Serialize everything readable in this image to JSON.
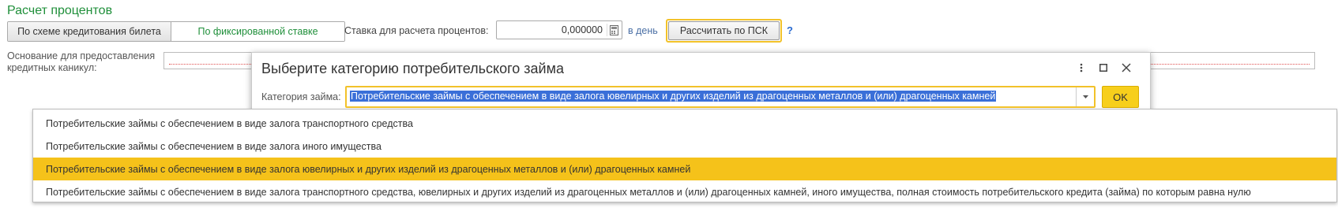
{
  "section": {
    "title": "Расчет процентов"
  },
  "scheme": {
    "options": [
      "По схеме кредитования билета",
      "По фиксированной ставке"
    ],
    "selected_index": 1
  },
  "rate": {
    "label": "Ставка для расчета процентов:",
    "value": "0,000000",
    "unit": "в день"
  },
  "psk_button": "Рассчитать по ПСК",
  "help": "?",
  "basis": {
    "label": "Основание для предоставления кредитных каникул:",
    "value": ""
  },
  "dialog": {
    "title": "Выберите категорию потребительского займа",
    "category_label": "Категория займа:",
    "category_value": "Потребительские займы с обеспечением в виде залога ювелирных и других изделий из драгоценных металлов и (или) драгоценных камней",
    "ok_label": "OK",
    "icons": [
      "more-icon",
      "maximize-icon",
      "close-icon"
    ]
  },
  "dropdown": {
    "items": [
      "Потребительские займы с обеспечением в виде залога транспортного средства",
      "Потребительские займы с обеспечением в виде залога иного имущества",
      "Потребительские займы с обеспечением в виде залога ювелирных и других изделий из драгоценных металлов и (или) драгоценных камней",
      "Потребительские займы с обеспечением в виде залога транспортного средства, ювелирных и других изделий из драгоценных металлов и (или) драгоценных камней, иного имущества, полная стоимость потребительского кредита (займа) по которым равна нулю"
    ],
    "selected_index": 2
  },
  "colors": {
    "accent_green": "#1f8f3a",
    "highlight_yellow": "#f5c21a",
    "selection_blue": "#3a6fd8"
  }
}
